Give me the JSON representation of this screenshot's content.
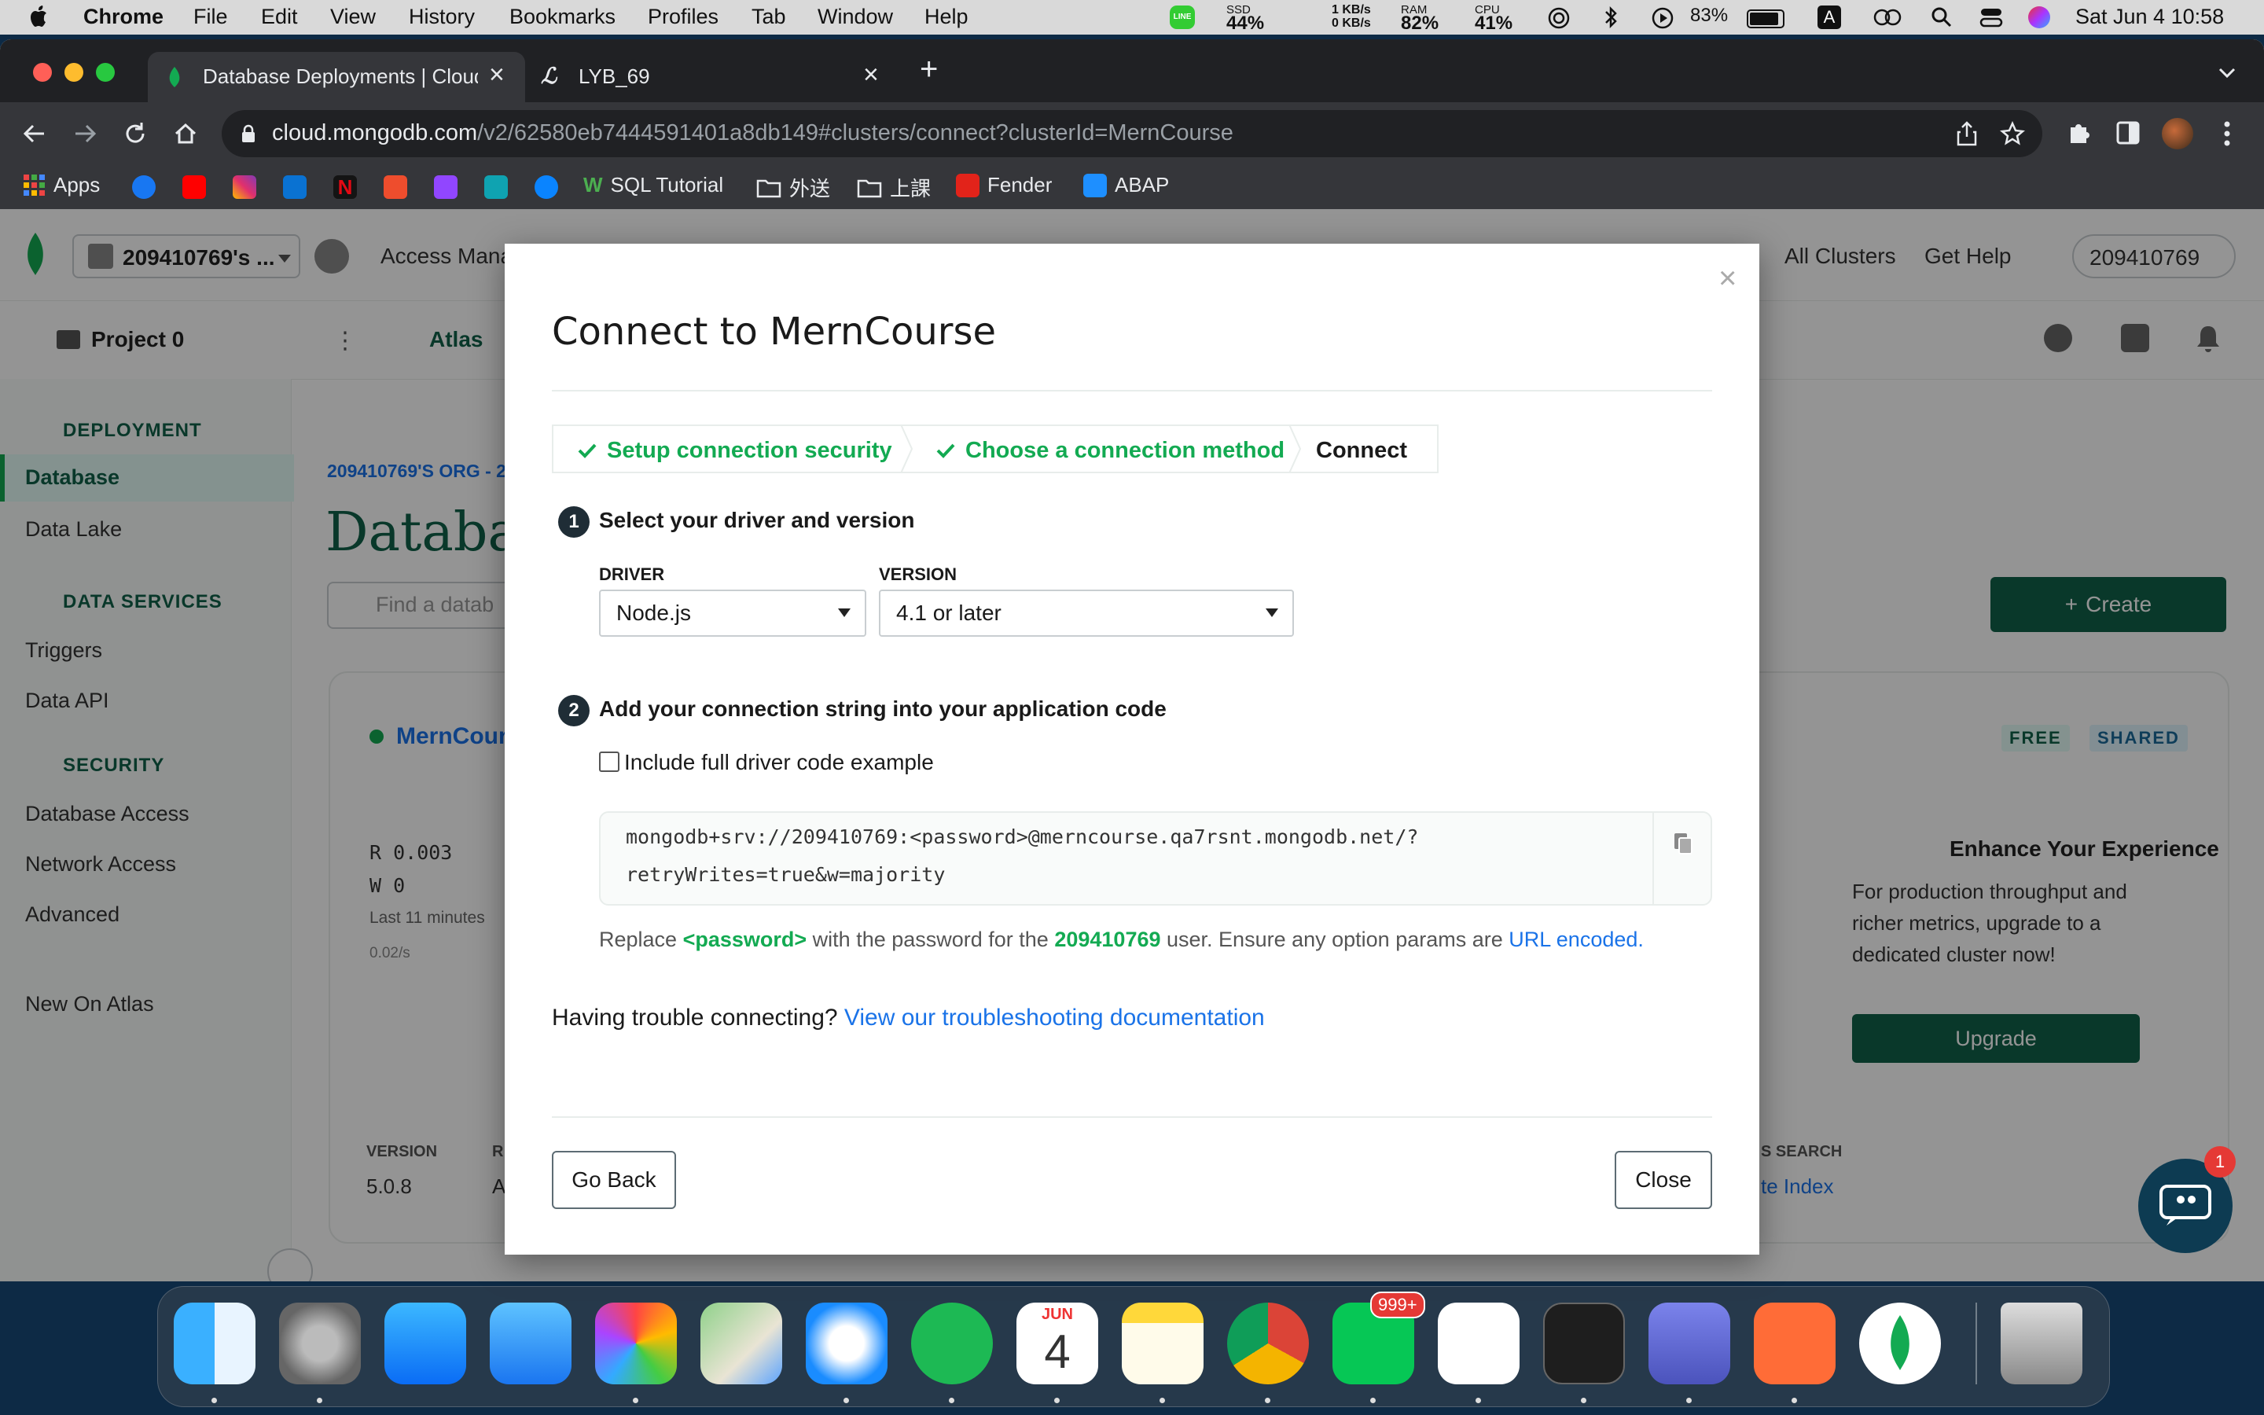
{
  "menubar": {
    "app": "Chrome",
    "items": [
      "File",
      "Edit",
      "View",
      "History",
      "Bookmarks",
      "Profiles",
      "Tab",
      "Window",
      "Help"
    ],
    "ssd": {
      "label": "SSD",
      "value": "44%"
    },
    "net": {
      "up": "1 KB/s",
      "down": "0 KB/s"
    },
    "ram": {
      "label": "RAM",
      "value": "82%"
    },
    "cpu": {
      "label": "CPU",
      "value": "41%"
    },
    "battery": "83%",
    "input_method": "A",
    "datetime": "Sat Jun 4  10:58"
  },
  "tabs": [
    {
      "title": "Database Deployments | Cloud",
      "active": true
    },
    {
      "title": "LYB_69",
      "active": false
    }
  ],
  "url": {
    "host": "cloud.mongodb.com",
    "path": "/v2/62580eb7444591401a8db149#clusters/connect?clusterId=MernCourse"
  },
  "bookmarks": [
    "Apps",
    "SQL Tutorial",
    "外送",
    "上課",
    "Fender",
    "ABAP"
  ],
  "atlas": {
    "org": "209410769's ...",
    "access_manager": "Access Mana",
    "all_clusters": "All Clusters",
    "get_help": "Get Help",
    "user": "209410769",
    "project": "Project 0",
    "atlas_tab": "Atlas",
    "sidebar": {
      "deployment": "DEPLOYMENT",
      "database": "Database",
      "data_lake": "Data Lake",
      "data_services": "DATA SERVICES",
      "triggers": "Triggers",
      "data_api": "Data API",
      "security": "SECURITY",
      "database_access": "Database Access",
      "network_access": "Network Access",
      "advanced": "Advanced",
      "new_on_atlas": "New On Atlas"
    },
    "breadcrumb": "209410769'S ORG - 2",
    "page_title": "Databa",
    "search_placeholder": "Find a datab",
    "create_label": "Create",
    "cluster_name": "MernCour",
    "free_badge": "FREE",
    "shared_badge": "SHARED",
    "metrics": {
      "r": "R 0.003",
      "w": "W 0",
      "period": "Last 11 minutes",
      "rate": "0.02/s"
    },
    "version_label": "VERSION",
    "version_value": "5.0.8",
    "r_col": "R",
    "a_col": "A",
    "search_col": "S SEARCH",
    "index_link": "te Index",
    "promo": {
      "title": "Enhance Your Experience",
      "body": "For production throughput and richer metrics, upgrade to a dedicated cluster now!",
      "button": "Upgrade"
    },
    "chat_badge": "1"
  },
  "modal": {
    "title": "Connect to MernCourse",
    "steps": [
      "Setup connection security",
      "Choose a connection method",
      "Connect"
    ],
    "step1": {
      "num": "1",
      "title": "Select your driver and version"
    },
    "driver_label": "DRIVER",
    "driver_value": "Node.js",
    "version_label": "VERSION",
    "version_value": "4.1 or later",
    "step2": {
      "num": "2",
      "title": "Add your connection string into your application code"
    },
    "checkbox_label": "Include full driver code example",
    "conn_line1": "mongodb+srv://209410769:<password>@merncourse.qa7rsnt.mongodb.net/?",
    "conn_line2": "retryWrites=true&w=majority",
    "replace": {
      "prefix": "Replace",
      "password": "<password>",
      "mid": "with the password for the",
      "user": "209410769",
      "suffix": "user. Ensure any option params are",
      "link": "URL encoded."
    },
    "trouble": {
      "text": "Having trouble connecting?",
      "link": "View our troubleshooting documentation"
    },
    "go_back": "Go Back",
    "close": "Close"
  },
  "dock": {
    "calendar_month": "JUN",
    "calendar_day": "4",
    "line_badge": "999+"
  },
  "colors": {
    "green": "#13aa52",
    "dark_green": "#116149",
    "link_blue": "#1a73e8",
    "modal_title": "#1a1a1a"
  }
}
